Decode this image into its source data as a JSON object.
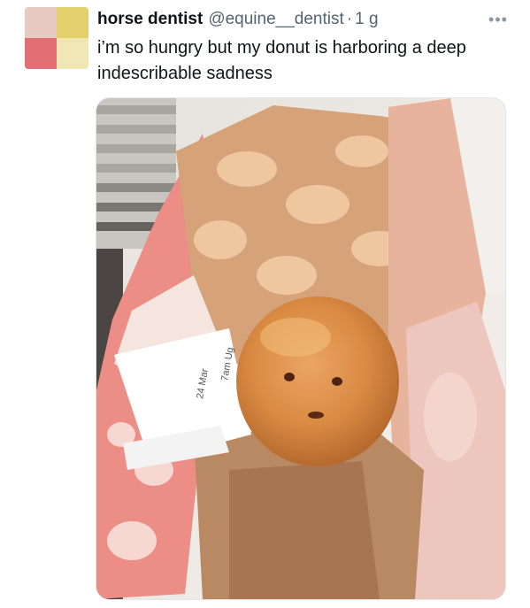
{
  "tweet": {
    "display_name": "horse dentist",
    "handle": "@equine__dentist",
    "separator": "·",
    "time": "1 g",
    "more_icon": "more-horizontal-icon",
    "text": "i’m so hungry but my donut is harboring a deep indescribable sadness"
  },
  "media": {
    "receipt_text": "24 Mar",
    "receipt_text_2": "7am Ug"
  }
}
